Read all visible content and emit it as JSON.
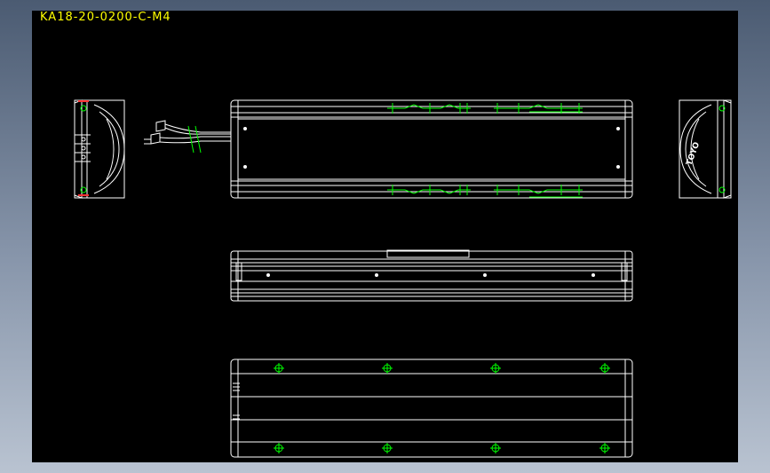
{
  "drawing": {
    "title": "KA18-20-0200-C-M4",
    "end_cap_marking": "TOYO",
    "colors": {
      "background": "#000000",
      "outline": "#ffffff",
      "detail": "#00ff00",
      "marker": "#ff3333",
      "title": "#ffff00"
    }
  }
}
